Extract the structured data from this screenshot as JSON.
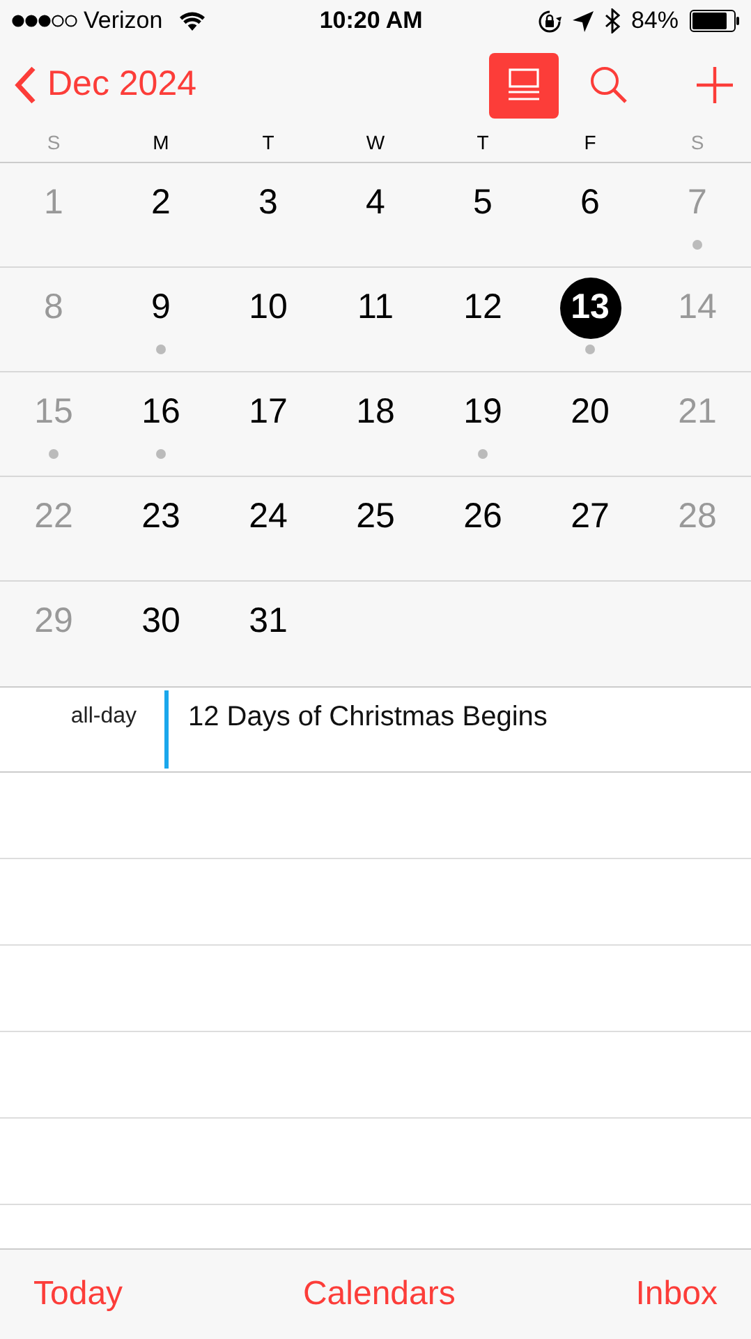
{
  "status_bar": {
    "carrier": "Verizon",
    "time": "10:20 AM",
    "battery": "84%"
  },
  "nav": {
    "back": "Dec 2024",
    "list_view": {
      "selected": true
    }
  },
  "weekdays": [
    {
      "label": "S",
      "dimmed": true
    },
    {
      "label": "M",
      "dimmed": false
    },
    {
      "label": "T",
      "dimmed": false
    },
    {
      "label": "W",
      "dimmed": false
    },
    {
      "label": "T",
      "dimmed": false
    },
    {
      "label": "F",
      "dimmed": false
    },
    {
      "label": "S",
      "dimmed": true
    }
  ],
  "weeks": [
    [
      {
        "day": "1",
        "dimmed": true,
        "dot": false,
        "selected": false
      },
      {
        "day": "2",
        "dimmed": false,
        "dot": false,
        "selected": false
      },
      {
        "day": "3",
        "dimmed": false,
        "dot": false,
        "selected": false
      },
      {
        "day": "4",
        "dimmed": false,
        "dot": false,
        "selected": false
      },
      {
        "day": "5",
        "dimmed": false,
        "dot": false,
        "selected": false
      },
      {
        "day": "6",
        "dimmed": false,
        "dot": false,
        "selected": false
      },
      {
        "day": "7",
        "dimmed": true,
        "dot": true,
        "selected": false
      }
    ],
    [
      {
        "day": "8",
        "dimmed": true,
        "dot": false,
        "selected": false
      },
      {
        "day": "9",
        "dimmed": false,
        "dot": true,
        "selected": false
      },
      {
        "day": "10",
        "dimmed": false,
        "dot": false,
        "selected": false
      },
      {
        "day": "11",
        "dimmed": false,
        "dot": false,
        "selected": false
      },
      {
        "day": "12",
        "dimmed": false,
        "dot": false,
        "selected": false
      },
      {
        "day": "13",
        "dimmed": false,
        "dot": true,
        "selected": true
      },
      {
        "day": "14",
        "dimmed": true,
        "dot": false,
        "selected": false
      }
    ],
    [
      {
        "day": "15",
        "dimmed": true,
        "dot": true,
        "selected": false
      },
      {
        "day": "16",
        "dimmed": false,
        "dot": true,
        "selected": false
      },
      {
        "day": "17",
        "dimmed": false,
        "dot": false,
        "selected": false
      },
      {
        "day": "18",
        "dimmed": false,
        "dot": false,
        "selected": false
      },
      {
        "day": "19",
        "dimmed": false,
        "dot": true,
        "selected": false
      },
      {
        "day": "20",
        "dimmed": false,
        "dot": false,
        "selected": false
      },
      {
        "day": "21",
        "dimmed": true,
        "dot": false,
        "selected": false
      }
    ],
    [
      {
        "day": "22",
        "dimmed": true,
        "dot": false,
        "selected": false
      },
      {
        "day": "23",
        "dimmed": false,
        "dot": false,
        "selected": false
      },
      {
        "day": "24",
        "dimmed": false,
        "dot": false,
        "selected": false
      },
      {
        "day": "25",
        "dimmed": false,
        "dot": false,
        "selected": false
      },
      {
        "day": "26",
        "dimmed": false,
        "dot": false,
        "selected": false
      },
      {
        "day": "27",
        "dimmed": false,
        "dot": false,
        "selected": false
      },
      {
        "day": "28",
        "dimmed": true,
        "dot": false,
        "selected": false
      }
    ],
    [
      {
        "day": "29",
        "dimmed": true,
        "dot": false,
        "selected": false
      },
      {
        "day": "30",
        "dimmed": false,
        "dot": false,
        "selected": false
      },
      {
        "day": "31",
        "dimmed": false,
        "dot": false,
        "selected": false
      }
    ]
  ],
  "all_day": {
    "label": "all-day",
    "events": [
      {
        "title": "12 Days of Christmas Begins",
        "color": "#1aa7ec"
      }
    ]
  },
  "tab_bar": [
    "Today",
    "Calendars",
    "Inbox"
  ]
}
